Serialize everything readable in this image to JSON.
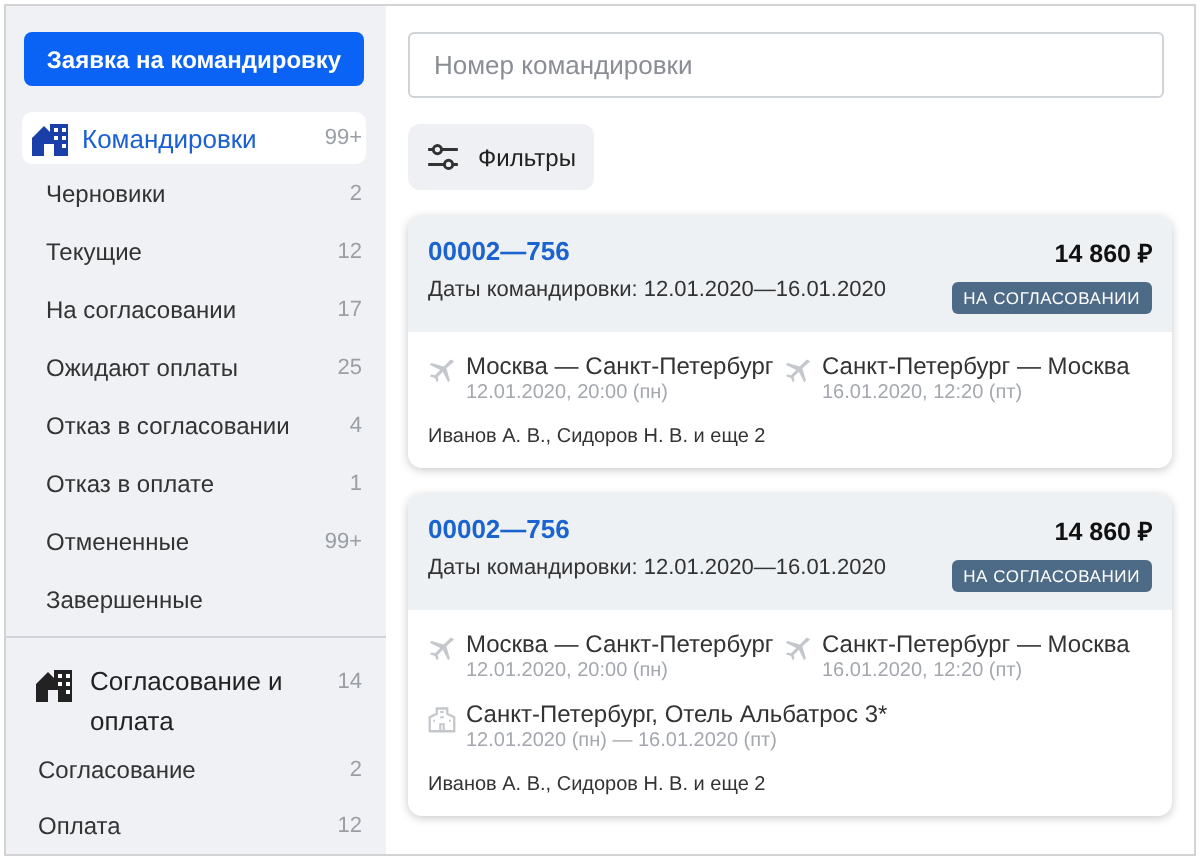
{
  "sidebar": {
    "create_button": "Заявка на командировку",
    "groups": [
      {
        "label": "Командировки",
        "count": "99+",
        "selected": true,
        "children": [
          {
            "label": "Черновики",
            "count": "2",
            "selected": false
          },
          {
            "label": "Текущие",
            "count": "12",
            "selected": false
          },
          {
            "label": "На согласовании",
            "count": "17",
            "selected": false
          },
          {
            "label": "Ожидают оплаты",
            "count": "25",
            "selected": false
          },
          {
            "label": "Отказ в согласовании",
            "count": "4",
            "selected": false
          },
          {
            "label": "Отказ в оплате",
            "count": "1",
            "selected": false
          },
          {
            "label": "Отмененные",
            "count": "99+",
            "selected": false
          },
          {
            "label": "Завершенные",
            "selected": false
          }
        ]
      },
      {
        "label": "Согласование и оплата",
        "count": "14",
        "selected": false,
        "children": [
          {
            "label": "Согласование",
            "count": "2",
            "selected": false
          },
          {
            "label": "Оплата",
            "count": "12",
            "selected": false
          }
        ]
      }
    ]
  },
  "search": {
    "placeholder": "Номер командировки"
  },
  "filters_button": "Фильтры",
  "cards": [
    {
      "number": "00002—756",
      "price": "14 860 ₽",
      "dates": "Даты командировки: 12.01.2020—16.01.2020",
      "status": "НА СОГЛАСОВАНИИ",
      "segments": [
        {
          "kind": "flight",
          "title": "Москва — Санкт-Петербург",
          "time": "12.01.2020, 20:00 (пн)"
        },
        {
          "kind": "flight",
          "title": "Санкт-Петербург — Москва",
          "time": "16.01.2020, 12:20 (пт)"
        }
      ],
      "travelers": "Иванов А. В., Сидоров Н. В. и еще 2"
    },
    {
      "number": "00002—756",
      "price": "14 860 ₽",
      "dates": "Даты командировки: 12.01.2020—16.01.2020",
      "status": "НА СОГЛАСОВАНИИ",
      "segments": [
        {
          "kind": "flight",
          "title": "Москва — Санкт-Петербург",
          "time": "12.01.2020, 20:00 (пн)"
        },
        {
          "kind": "flight",
          "title": "Санкт-Петербург — Москва",
          "time": "16.01.2020, 12:20 (пт)"
        },
        {
          "kind": "hotel",
          "title": "Санкт-Петербург, Отель Альбатрос 3*",
          "time": "12.01.2020 (пн) — 16.01.2020 (пт)"
        }
      ],
      "travelers": "Иванов А. В., Сидоров Н. В. и еще 2"
    }
  ]
}
